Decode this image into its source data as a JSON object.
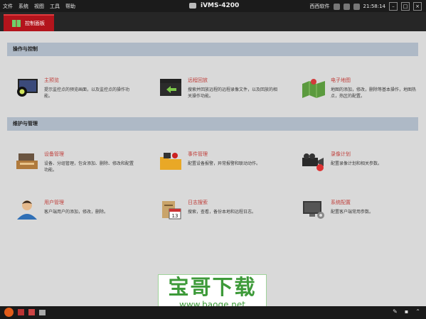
{
  "menu": [
    "文件",
    "系统",
    "视图",
    "工具",
    "帮助"
  ],
  "app_title": "iVMS-4200",
  "status": {
    "user": "西西软件",
    "time": "21:58:14"
  },
  "tab": {
    "label": "控制面板"
  },
  "sections": [
    {
      "title": "操作与控制",
      "items": [
        {
          "title": "主预览",
          "desc": "提示监控点的预览画面，以及监控点的操作功能。"
        },
        {
          "title": "远程回放",
          "desc": "搜索并回放远程的远程录像文件，以及回放的相关操作功能。"
        },
        {
          "title": "电子地图",
          "desc": "地图的添加，修改，删除等基本操作，地图热点，热区的配置。"
        }
      ]
    },
    {
      "title": "维护与管理",
      "items": [
        {
          "title": "设备管理",
          "desc": "设备、分组管理，包含添加、删除、修改和配置功能。"
        },
        {
          "title": "事件管理",
          "desc": "配置设备报警，异常报警和联动动作。"
        },
        {
          "title": "录像计划",
          "desc": "配置录像计划和相关参数。"
        },
        {
          "title": "用户管理",
          "desc": "客户端用户的添加，修改，删除。"
        },
        {
          "title": "日志搜索",
          "desc": "搜索，查看，备份本地和远程日志。"
        },
        {
          "title": "系统配置",
          "desc": "配置客户端常用参数。"
        }
      ]
    }
  ],
  "watermark": {
    "line1": "宝哥下载",
    "line2": "www.baoge.net"
  },
  "colors": {
    "accent": "#b3141c",
    "section_bg": "#aeb9c6",
    "title_red": "#c0403c"
  }
}
